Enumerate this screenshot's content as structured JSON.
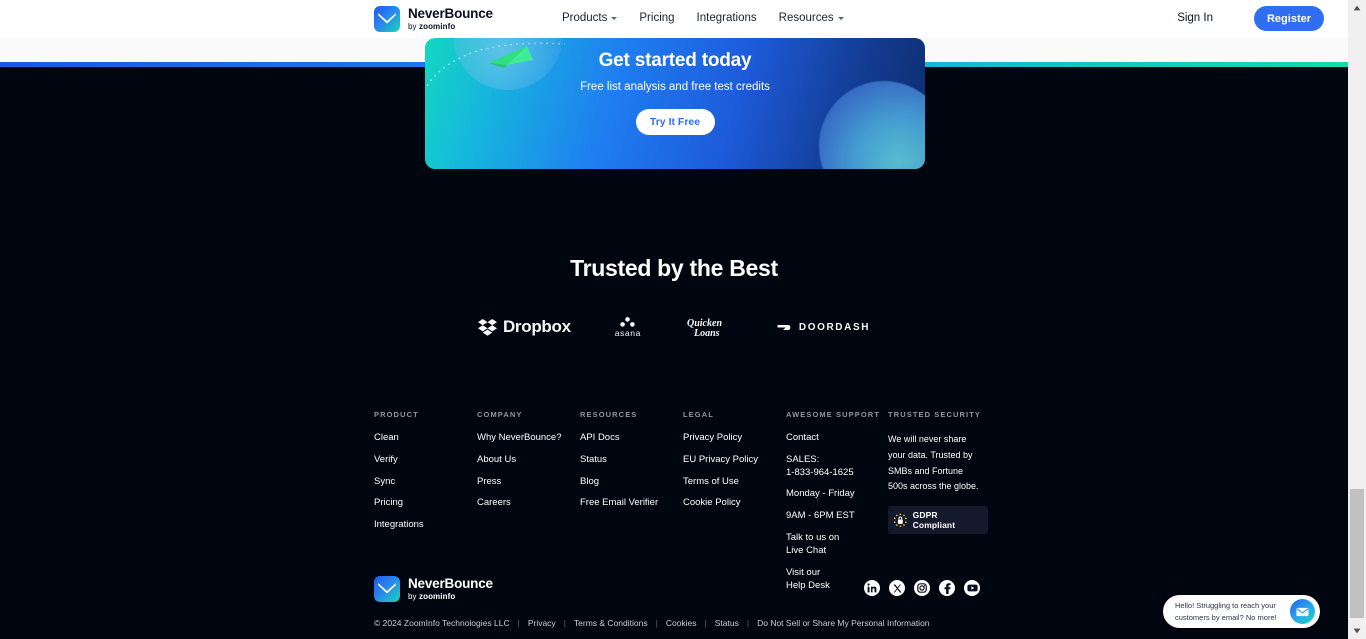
{
  "header": {
    "logo": {
      "name": "NeverBounce",
      "by": "by ",
      "parent": "zoominfo",
      "icon": "neverbounce-logo-icon"
    },
    "nav": [
      {
        "label": "Products",
        "has_caret": true
      },
      {
        "label": "Pricing",
        "has_caret": false
      },
      {
        "label": "Integrations",
        "has_caret": false
      },
      {
        "label": "Resources",
        "has_caret": true
      }
    ],
    "sign_in": "Sign In",
    "register": "Register",
    "register_color": "#2f6ef0"
  },
  "cta": {
    "title": "Get started today",
    "subtitle": "Free list analysis and free test credits",
    "button": "Try It Free",
    "button_text_color": "#2f6ef0"
  },
  "trusted": {
    "title": "Trusted by the Best",
    "logos": [
      {
        "name": "Dropbox",
        "icon": "dropbox-logo-icon"
      },
      {
        "name": "asana",
        "icon": "asana-logo-icon"
      },
      {
        "name": "Quicken Loans",
        "icon": "quicken-loans-logo-icon"
      },
      {
        "name": "DOORDASH",
        "icon": "doordash-logo-icon"
      }
    ]
  },
  "footer": {
    "columns": [
      {
        "heading": "PRODUCT",
        "links": [
          "Clean",
          "Verify",
          "Sync",
          "Pricing",
          "Integrations"
        ]
      },
      {
        "heading": "COMPANY",
        "links": [
          "Why NeverBounce?",
          "About Us",
          "Press",
          "Careers"
        ]
      },
      {
        "heading": "RESOURCES",
        "links": [
          "API Docs",
          "Status",
          "Blog",
          "Free Email Verifier"
        ]
      },
      {
        "heading": "LEGAL",
        "links": [
          "Privacy Policy",
          "EU Privacy Policy",
          "Terms of Use",
          "Cookie Policy"
        ]
      }
    ],
    "support": {
      "heading": "AWESOME SUPPORT",
      "contact": "Contact",
      "sales_label": "SALES: ",
      "sales_phone": "1-833-964-1625",
      "days": "Monday - Friday",
      "hours": "9AM - 6PM EST",
      "chat_prefix": "Talk to us on ",
      "chat_link": "Live Chat",
      "helpdesk_prefix": "Visit our ",
      "helpdesk_link": "Help Desk"
    },
    "security": {
      "heading": "TRUSTED SECURITY",
      "text": "We will never share your data. Trusted by SMBs and Fortune 500s across the globe.",
      "badge_label": "GDPR Compliant",
      "badge_icon": "gdpr-lock-icon"
    }
  },
  "bottom": {
    "logo": {
      "name": "NeverBounce",
      "by": "by ",
      "parent": "zoominfo"
    },
    "copyright": "© 2024 ZoomInfo Technologies LLC",
    "links": [
      "Privacy",
      "Terms & Conditions",
      "Cookies",
      "Status",
      "Do Not Sell or Share My Personal Information"
    ],
    "separator": "|",
    "socials": [
      {
        "name": "linkedin-icon"
      },
      {
        "name": "x-twitter-icon"
      },
      {
        "name": "instagram-icon"
      },
      {
        "name": "facebook-icon"
      },
      {
        "name": "youtube-icon"
      }
    ]
  },
  "chat_widget": {
    "message": "Hello! Struggling to reach your customers by email? No more!",
    "icon": "chat-envelope-icon"
  },
  "colors": {
    "page_bg": "#000610",
    "accent_blue": "#2f6ef0",
    "link_blue": "#3d8bfd",
    "heading_gray": "#8d97a8"
  }
}
